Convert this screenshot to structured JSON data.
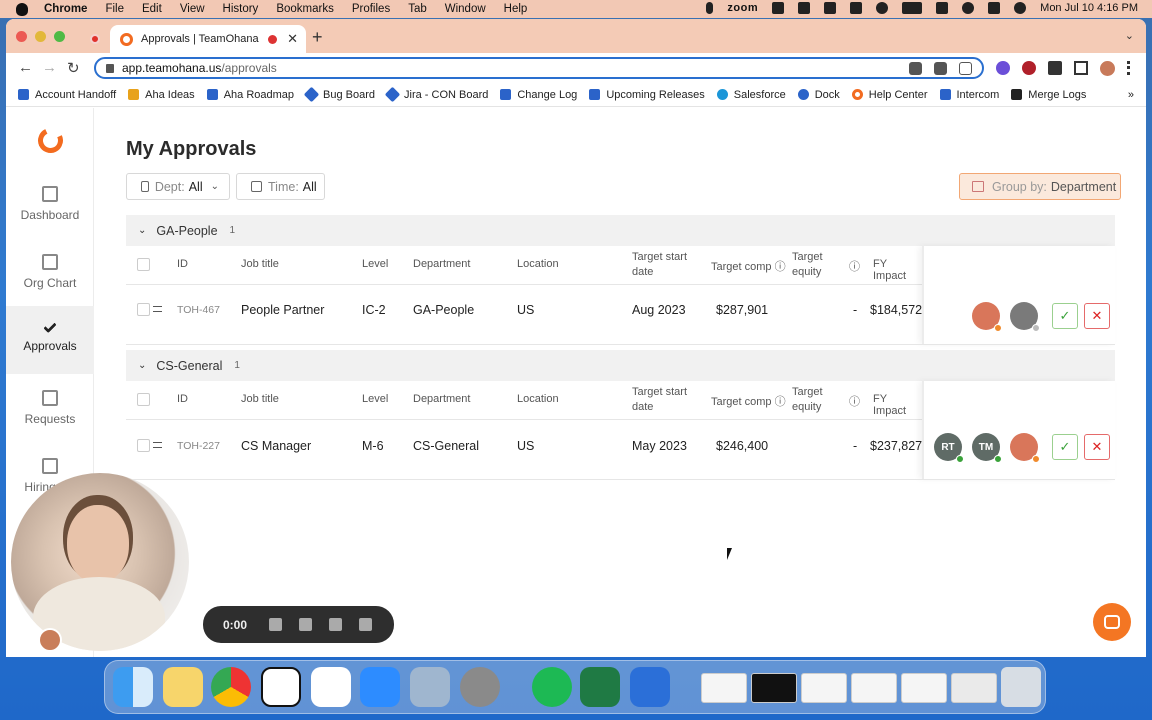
{
  "menubar": {
    "app": "Chrome",
    "items": [
      "File",
      "Edit",
      "View",
      "History",
      "Bookmarks",
      "Profiles",
      "Tab",
      "Window",
      "Help"
    ],
    "zoom_label": "zoom",
    "datetime": "Mon Jul 10  4:16 PM"
  },
  "browser": {
    "tab_title": "Approvals | TeamOhana",
    "url_host": "app.teamohana.us",
    "url_path": "/approvals",
    "bookmarks": [
      {
        "label": "Account Handoff",
        "color": "#2b63c9"
      },
      {
        "label": "Aha Ideas",
        "color": "#e8a21b"
      },
      {
        "label": "Aha Roadmap",
        "color": "#2b63c9"
      },
      {
        "label": "Bug Board",
        "color": "#2b63c9"
      },
      {
        "label": "Jira - CON Board",
        "color": "#2b63c9"
      },
      {
        "label": "Change Log",
        "color": "#2b63c9"
      },
      {
        "label": "Upcoming Releases",
        "color": "#2b63c9"
      },
      {
        "label": "Salesforce",
        "color": "#1b96d8"
      },
      {
        "label": "Dock",
        "color": "#2b63c9"
      },
      {
        "label": "Help Center",
        "color": "#f26b21"
      },
      {
        "label": "Intercom",
        "color": "#2b63c9"
      },
      {
        "label": "Merge Logs",
        "color": "#222222"
      }
    ],
    "bookmarks_more": "»"
  },
  "sidebar": {
    "items": [
      {
        "label": "Dashboard",
        "icon": "grid-icon"
      },
      {
        "label": "Org Chart",
        "icon": "org-chart-icon"
      },
      {
        "label": "Approvals",
        "icon": "check-icon",
        "active": true
      },
      {
        "label": "Requests",
        "icon": "document-icon"
      },
      {
        "label": "Hiring P...",
        "icon": "calendar-icon"
      }
    ]
  },
  "page": {
    "title": "My Approvals",
    "filters": {
      "dept_label": "Dept:",
      "dept_value": "All",
      "time_label": "Time:",
      "time_value": "All",
      "group_label": "Group by:",
      "group_value": "Department"
    },
    "columns": {
      "id": "ID",
      "job_title": "Job title",
      "level": "Level",
      "department": "Department",
      "location": "Location",
      "target_start_1": "Target start",
      "target_start_2": "date",
      "target_comp": "Target comp",
      "target_equity_1": "Target",
      "target_equity_2": "equity",
      "fy_impact": "FY Impact"
    },
    "groups": [
      {
        "name": "GA-People",
        "count": "1",
        "row": {
          "id": "TOH-467",
          "job_title": "People Partner",
          "level": "IC-2",
          "department": "GA-People",
          "location": "US",
          "target_start": "Aug 2023",
          "target_comp": "$287,901",
          "target_equity": "-",
          "fy_impact": "$184,572",
          "approvers": []
        }
      },
      {
        "name": "CS-General",
        "count": "1",
        "row": {
          "id": "TOH-227",
          "job_title": "CS Manager",
          "level": "M-6",
          "department": "CS-General",
          "location": "US",
          "target_start": "May 2023",
          "target_comp": "$246,400",
          "target_equity": "-",
          "fy_impact": "$237,827",
          "approvers": [
            "RT",
            "TM"
          ]
        }
      }
    ]
  },
  "recorder": {
    "time": "0:00"
  },
  "colors": {
    "brand": "#f36b1f",
    "approve": "#3aa23a",
    "reject": "#d22222"
  }
}
